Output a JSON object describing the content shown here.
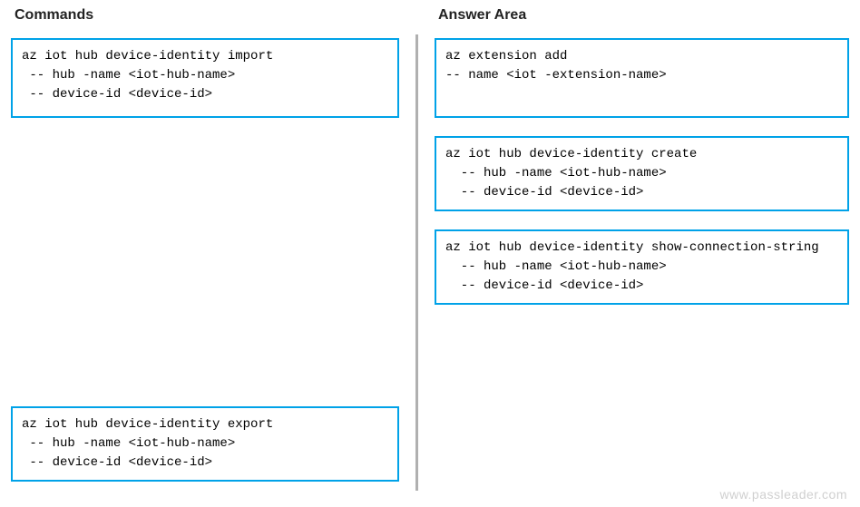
{
  "left": {
    "heading": "Commands",
    "box1": "az iot hub device-identity import\n -- hub -name <iot-hub-name>\n -- device-id <device-id>",
    "box2": "az iot hub device-identity export\n -- hub -name <iot-hub-name>\n -- device-id <device-id>"
  },
  "right": {
    "heading": "Answer Area",
    "box1": "az extension add\n-- name <iot -extension-name>",
    "box2": "az iot hub device-identity create\n  -- hub -name <iot-hub-name>\n  -- device-id <device-id>",
    "box3": "az iot hub device-identity show-connection-string\n  -- hub -name <iot-hub-name>\n  -- device-id <device-id>"
  },
  "watermark": "www.passleader.com"
}
